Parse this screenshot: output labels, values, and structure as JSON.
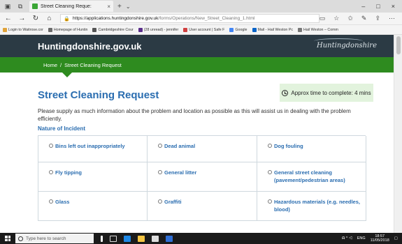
{
  "browser": {
    "tab_title": "Street Cleaning Reque:",
    "tab_close": "×",
    "new_tab": "+",
    "tab_menu": "⌄",
    "window_controls": [
      "–",
      "□",
      "×"
    ],
    "url_host": "https://applications.huntingdonshire.gov.uk",
    "url_path": "/forms/Operations/New_Street_Cleaning_1.html",
    "nav": [
      "←",
      "→",
      "↻",
      "⌂"
    ],
    "right_icons": [
      "▭",
      "☆",
      "✩",
      "✎",
      "⇪",
      "⋯"
    ],
    "favourites": [
      {
        "label": "Login to Waitrose.cor",
        "color": "#e0a33a"
      },
      {
        "label": "Homepage of Huntin",
        "color": "#6b6b6b"
      },
      {
        "label": "Cambridgeshire Cour",
        "color": "#555555"
      },
      {
        "label": "(28 unread) - jennifer",
        "color": "#5a2e8b"
      },
      {
        "label": "User account | Safe F",
        "color": "#d04040"
      },
      {
        "label": "Google",
        "color": "#4285f4"
      },
      {
        "label": "Mail - Hail Weston Pc",
        "color": "#0a64c8"
      },
      {
        "label": "Hail Weston – Comm",
        "color": "#777777"
      }
    ]
  },
  "site": {
    "name": "Huntingdonshire.gov.uk",
    "logo_text": "Huntingdonshire",
    "breadcrumb": {
      "home": "Home",
      "separator": "/",
      "current": "Street Cleaning Request"
    }
  },
  "main": {
    "title": "Street Cleaning Request",
    "time_notice": "Approx time to complete: 4 mins",
    "intro": "Please supply as much information about the problem and location as possible as this will assist us in dealing with the problem efficiently.",
    "section_label": "Nature of Incident",
    "options": [
      "Bins left out inappropriately",
      "Dead animal",
      "Dog fouling",
      "Fly tipping",
      "General litter",
      "General street cleaning (pavement/pedestrian areas)",
      "Glass",
      "Graffiti",
      "Hazardous materials (e.g. needles, blood)"
    ]
  },
  "taskbar": {
    "search_placeholder": "Type here to search",
    "tray_lang": "ENG",
    "time": "18:57",
    "date": "11/05/2018",
    "tray_icons": "ᕱ ^ ◁"
  },
  "colors": {
    "header_bg": "#2b3a44",
    "breadcrumb_bg": "#2e8b1f",
    "accent_blue": "#2a6db0",
    "notice_bg": "#e2f3dd"
  }
}
